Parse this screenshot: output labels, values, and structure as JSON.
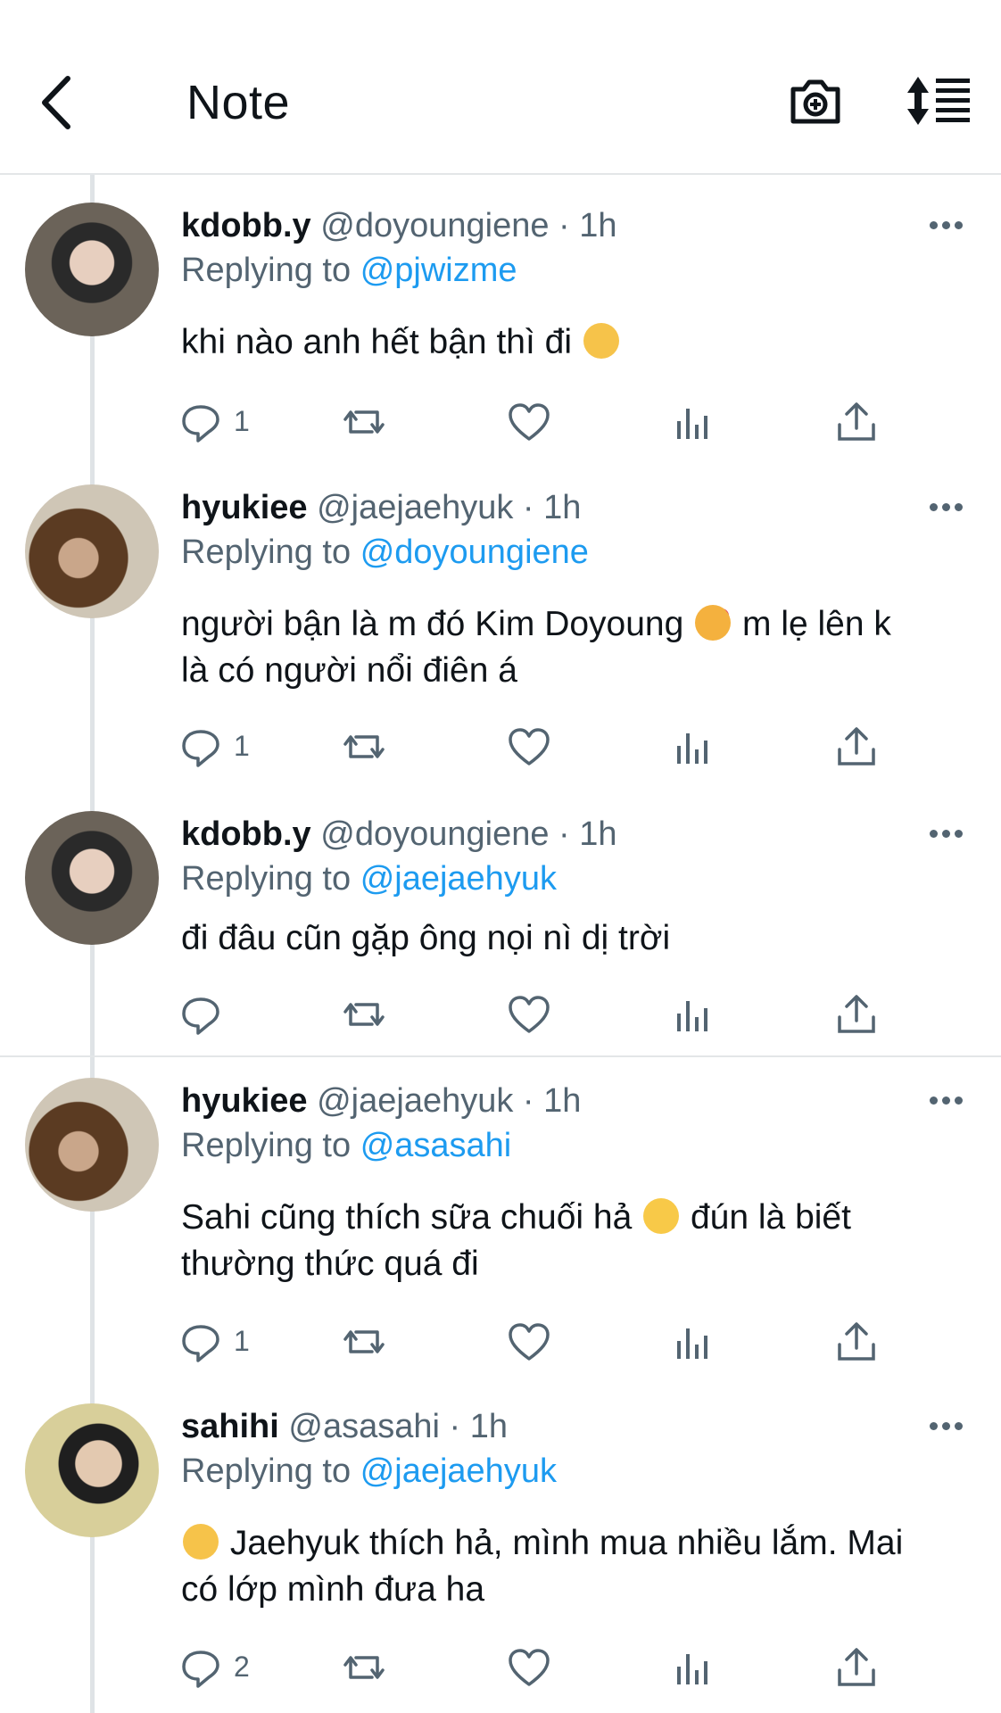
{
  "header": {
    "title": "Note"
  },
  "tweets": [
    {
      "name": "kdobb.y",
      "handle": "@doyoungiene",
      "time": "· 1h",
      "replying_label": "Replying to",
      "replying_to": "@pjwizme",
      "lines": [
        "khi nào anh hết bận thì đi"
      ],
      "emoji": "smiling-face",
      "reply_count": "1"
    },
    {
      "name": "hyukiee",
      "handle": "@jaejaehyuk",
      "time": "· 1h",
      "replying_label": "Replying to",
      "replying_to": "@doyoungiene",
      "line1_a": "người bận là m đó Kim Doyoung",
      "line1_b": "m lẹ lên k",
      "line2": "là có người nổi điên á",
      "reply_count": "1"
    },
    {
      "name": "kdobb.y",
      "handle": "@doyoungiene",
      "time": "· 1h",
      "replying_label": "Replying to",
      "replying_to": "@jaejaehyuk",
      "line1": "đi đâu cũn gặp ông nọi nì dị trời",
      "reply_count": ""
    },
    {
      "name": "hyukiee",
      "handle": "@jaejaehyuk",
      "time": "· 1h",
      "replying_label": "Replying to",
      "replying_to": "@asasahi",
      "line1_a": "Sahi cũng thích sữa chuối hả",
      "line1_b": "đún là biết",
      "line2": "thường thức quá đi",
      "reply_count": "1"
    },
    {
      "name": "sahihi",
      "handle": "@asasahi",
      "time": "· 1h",
      "replying_label": "Replying to",
      "replying_to": "@jaejaehyuk",
      "line1": "Jaehyuk thích hả, mình mua nhiều lắm. Mai",
      "line2": "có lớp mình đưa ha",
      "reply_count": "2"
    }
  ],
  "icons": {
    "back": "chevron-left-icon",
    "camera": "camera-plus-icon",
    "sort": "sort-icon",
    "reply": "reply-icon",
    "retweet": "retweet-icon",
    "like": "heart-icon",
    "views": "analytics-icon",
    "share": "share-icon",
    "more": "more-icon"
  },
  "colors": {
    "accent": "#1d9bf0",
    "secondary_text": "#536471",
    "text": "#0f1419"
  }
}
